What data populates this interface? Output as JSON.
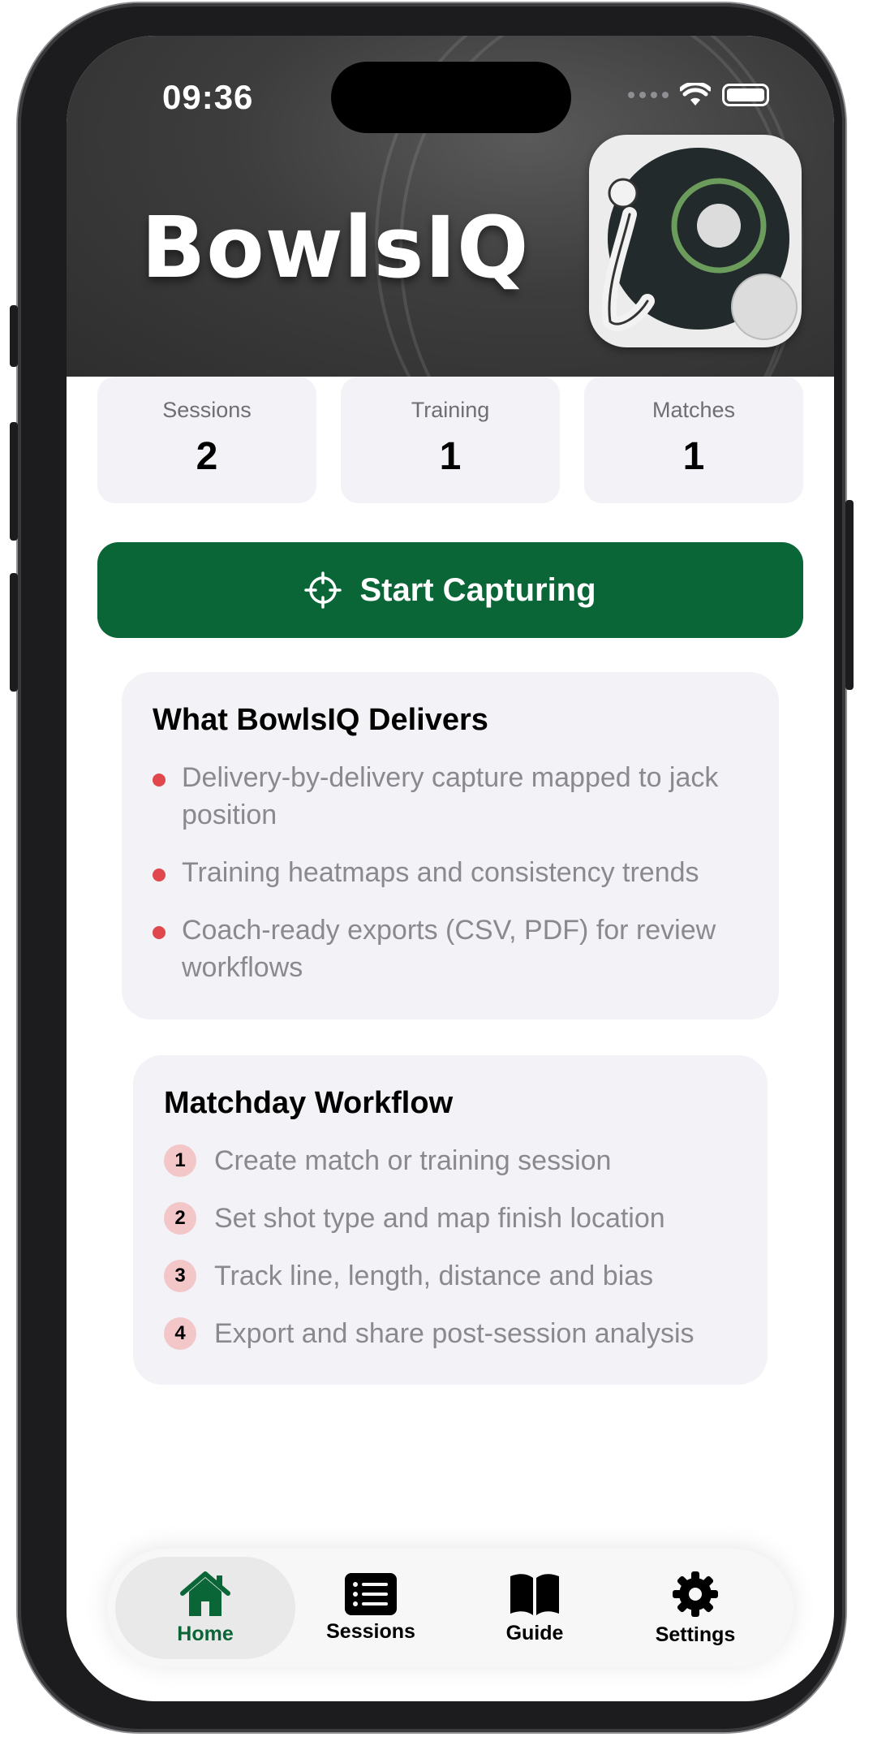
{
  "status_bar": {
    "time": "09:36"
  },
  "header": {
    "app_name": "BowlsIQ",
    "logo_icon": "bowlsiq-logo-icon"
  },
  "stats": [
    {
      "label": "Sessions",
      "value": "2"
    },
    {
      "label": "Training",
      "value": "1"
    },
    {
      "label": "Matches",
      "value": "1"
    }
  ],
  "cta": {
    "label": "Start Capturing",
    "icon": "crosshair-icon"
  },
  "delivers": {
    "title": "What BowlsIQ Delivers",
    "items": [
      "Delivery-by-delivery capture mapped to jack position",
      "Training heatmaps and consistency trends",
      "Coach-ready exports (CSV, PDF) for review workflows"
    ]
  },
  "workflow": {
    "title": "Matchday Workflow",
    "steps": [
      {
        "num": "1",
        "text": "Create match or training session"
      },
      {
        "num": "2",
        "text": "Set shot type and map finish location"
      },
      {
        "num": "3",
        "text": "Track line, length, distance and bias"
      },
      {
        "num": "4",
        "text": "Export and share post-session analysis"
      }
    ]
  },
  "tabbar": {
    "tabs": [
      {
        "label": "Home",
        "icon": "house-icon",
        "active": true
      },
      {
        "label": "Sessions",
        "icon": "list-icon",
        "active": false
      },
      {
        "label": "Guide",
        "icon": "book-icon",
        "active": false
      },
      {
        "label": "Settings",
        "icon": "gear-icon",
        "active": false
      }
    ]
  },
  "colors": {
    "accent": "#0a6637",
    "bullet": "#e0484d",
    "card_bg": "#f2f2f7"
  }
}
